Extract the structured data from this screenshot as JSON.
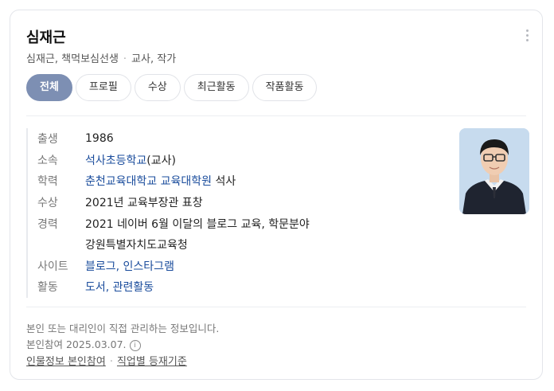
{
  "profile": {
    "name": "심재근",
    "aliases": "심재근, 책먹보심선생",
    "occupation": "교사, 작가"
  },
  "tabs": [
    {
      "label": "전체",
      "active": true
    },
    {
      "label": "프로필",
      "active": false
    },
    {
      "label": "수상",
      "active": false
    },
    {
      "label": "최근활동",
      "active": false
    },
    {
      "label": "작품활동",
      "active": false
    }
  ],
  "info": {
    "birth": {
      "label": "출생",
      "value": "1986"
    },
    "affiliation": {
      "label": "소속",
      "link": "석사초등학교",
      "suffix": "(교사)"
    },
    "education": {
      "label": "학력",
      "link": "춘천교육대학교 교육대학원",
      "suffix": " 석사"
    },
    "award": {
      "label": "수상",
      "value": "2021년 교육부장관 표창"
    },
    "career": {
      "label": "경력",
      "value1": "2021 네이버 6월 이달의 블로그 교육, 학문분야",
      "value2": "강원특별자치도교육청"
    },
    "site": {
      "label": "사이트",
      "link1": "블로그",
      "sep": ", ",
      "link2": "인스타그램"
    },
    "activity": {
      "label": "활동",
      "link1": "도서",
      "sep": ", ",
      "link2": "관련활동"
    }
  },
  "notice": {
    "line1": "본인 또는 대리인이 직접 관리하는 정보입니다.",
    "line2": "본인참여 2025.03.07.",
    "info_icon_glyph": "i"
  },
  "footer": {
    "link1": "인물정보 본인참여",
    "link2": "직업별 등재기준"
  },
  "colors": {
    "active_tab": "#7d8fb3",
    "link": "#1a4c9c"
  }
}
